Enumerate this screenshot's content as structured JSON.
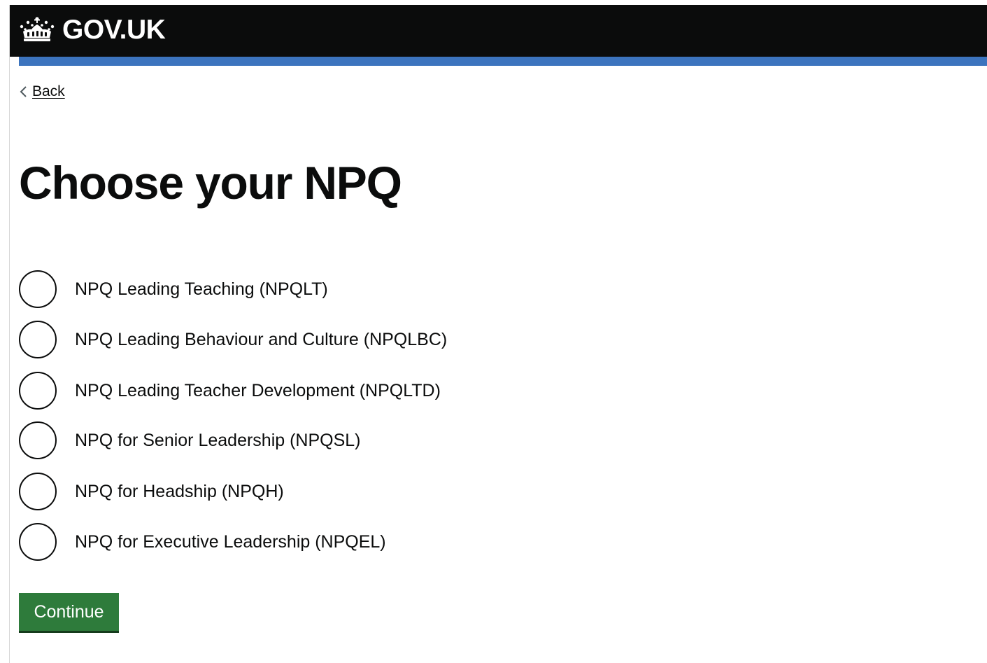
{
  "header": {
    "logo_text": "GOV.UK",
    "logo_icon": "crown-icon",
    "background_color": "#0b0c0c",
    "accent_bar_color": "#3c74be"
  },
  "nav": {
    "back_label": "Back",
    "back_icon": "chevron-left-icon"
  },
  "main": {
    "title": "Choose your NPQ",
    "options": [
      {
        "label": "NPQ Leading Teaching (NPQLT)",
        "selected": false
      },
      {
        "label": "NPQ Leading Behaviour and Culture (NPQLBC)",
        "selected": false
      },
      {
        "label": "NPQ Leading Teacher Development (NPQLTD)",
        "selected": false
      },
      {
        "label": "NPQ for Senior Leadership (NPQSL)",
        "selected": false
      },
      {
        "label": "NPQ for Headship (NPQH)",
        "selected": false
      },
      {
        "label": "NPQ for Executive Leadership (NPQEL)",
        "selected": false
      }
    ],
    "continue_label": "Continue",
    "button_color": "#2e7b3b"
  }
}
